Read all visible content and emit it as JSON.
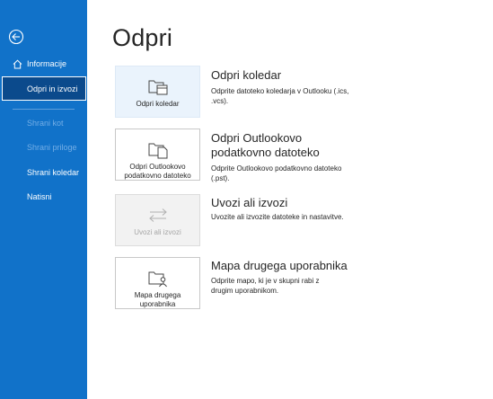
{
  "sidebar": {
    "back_icon": "back-arrow-icon",
    "home_icon": "home-icon",
    "items": [
      {
        "label": "Informacije",
        "state": "normal"
      },
      {
        "label": "Odpri in izvozi",
        "state": "selected"
      },
      {
        "label": "Shrani kot",
        "state": "disabled"
      },
      {
        "label": "Shrani priloge",
        "state": "disabled"
      },
      {
        "label": "Shrani koledar",
        "state": "normal"
      },
      {
        "label": "Natisni",
        "state": "normal"
      }
    ],
    "colors": {
      "background": "#1172c9",
      "selected": "#0b4a8c",
      "disabled_text": "#74aee6"
    }
  },
  "main": {
    "title": "Odpri",
    "options": [
      {
        "tile_label": "Odpri koledar",
        "icon": "folder-calendar-icon",
        "title": "Odpri koledar",
        "description": "Odprite datoteko koledarja v Outlooku (.ics, .vcs)."
      },
      {
        "tile_label": "Odpri Outlookovo podatkovno datoteko",
        "icon": "folder-data-file-icon",
        "title": "Odpri Outlookovo podatkovno datoteko",
        "description": "Odprite Outlookovo podatkovno datoteko (.pst)."
      },
      {
        "tile_label": "Uvozi ali izvozi",
        "icon": "import-export-arrows-icon",
        "title": "Uvozi ali izvozi",
        "description": "Uvozite ali izvozite datoteke in nastavitve.",
        "disabled": true
      },
      {
        "tile_label": "Mapa drugega uporabnika",
        "icon": "shared-folder-user-icon",
        "title": "Mapa drugega uporabnika",
        "description": "Odprite mapo, ki je v skupni rabi z drugim uporabnikom."
      }
    ]
  }
}
